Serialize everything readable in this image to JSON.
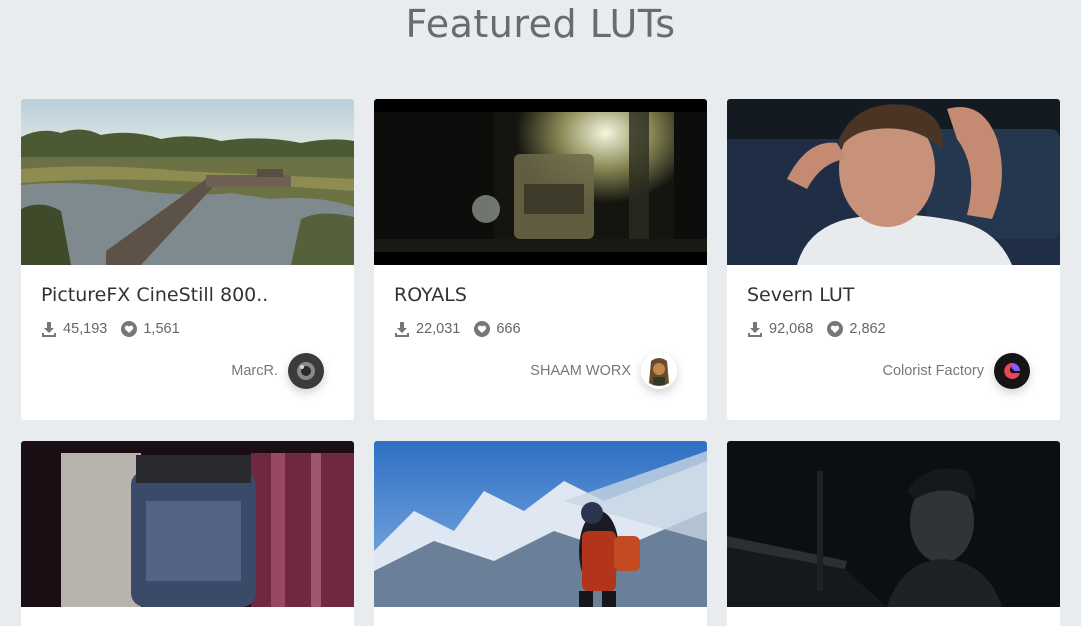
{
  "page": {
    "title": "Featured LUTs"
  },
  "cards": [
    {
      "title": "PictureFX CineStill 800..",
      "downloads": "45,193",
      "likes": "1,561",
      "author": "MarcR.",
      "download_icon": "download-icon",
      "like_icon": "heart-icon"
    },
    {
      "title": "ROYALS",
      "downloads": "22,031",
      "likes": "666",
      "author": "SHAAM WORX",
      "download_icon": "download-icon",
      "like_icon": "heart-icon"
    },
    {
      "title": "Severn LUT",
      "downloads": "92,068",
      "likes": "2,862",
      "author": "Colorist Factory",
      "download_icon": "download-icon",
      "like_icon": "heart-icon"
    }
  ],
  "colors": {
    "background": "#e9ecef",
    "card": "#ffffff",
    "title_text": "#6b6b6b",
    "accent_logo": "#e8465a"
  }
}
